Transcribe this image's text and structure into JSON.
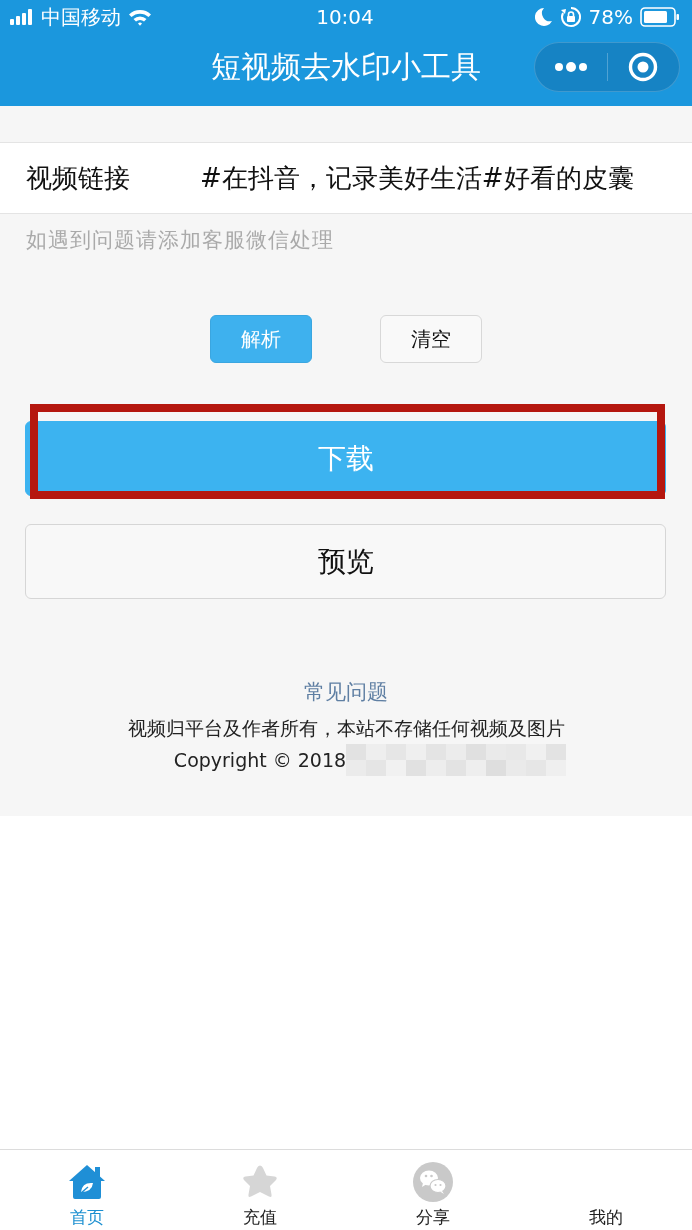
{
  "status_bar": {
    "carrier": "中国移动",
    "time": "10:04",
    "battery": "78%"
  },
  "nav_bar": {
    "title": "短视频去水印小工具"
  },
  "link_field": {
    "label": "视频链接",
    "value": "#在抖音，记录美好生活#好看的皮囊"
  },
  "hint": "如遇到问题请添加客服微信处理",
  "actions": [
    {
      "label": "解析",
      "kind": "primary"
    },
    {
      "label": "清空",
      "kind": "plain"
    }
  ],
  "main_buttons": [
    {
      "label": "下载",
      "kind": "primary",
      "highlighted": true
    },
    {
      "label": "预览",
      "kind": "plain",
      "highlighted": false
    }
  ],
  "faq_link": "常见问题",
  "disclaimer": "视频归平台及作者所有，本站不存储任何视频及图片",
  "copyright": "Copyright © 2018",
  "tab_bar": [
    {
      "label": "首页",
      "selected": true
    },
    {
      "label": "充值",
      "selected": false
    },
    {
      "label": "分享",
      "selected": false
    },
    {
      "label": "我的",
      "selected": false
    }
  ]
}
